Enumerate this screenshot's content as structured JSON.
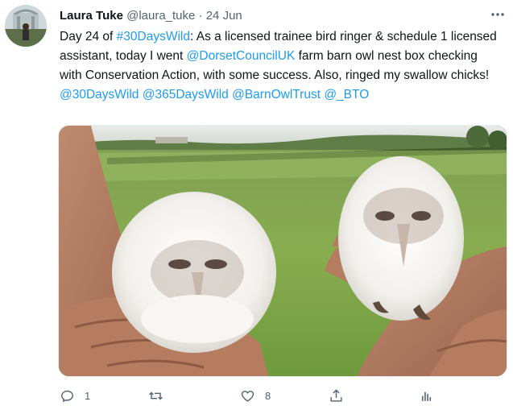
{
  "tweet": {
    "author_name": "Laura Tuke",
    "author_handle": "@laura_tuke",
    "separator": "·",
    "date": "24 Jun",
    "text_parts": {
      "p1": "Day 24 of ",
      "tag1": "#30DaysWild",
      "p2": ": As a licensed trainee bird ringer & schedule 1 licensed assistant, today I went ",
      "mention1": "@DorsetCouncilUK",
      "p3": " farm barn owl nest box checking with Conservation Action, with some success. Also, ringed my swallow chicks!"
    },
    "footer_links": {
      "tag1": "@30DaysWild",
      "tag2": "@365DaysWild",
      "tag3": "@BarnOwlTrust",
      "tag4": "@_BTO"
    }
  },
  "actions": {
    "reply_count": "1",
    "retweet_count": "",
    "like_count": "8"
  },
  "icons": {
    "more": "more-horizontal-icon",
    "reply": "reply-icon",
    "retweet": "retweet-icon",
    "like": "heart-icon",
    "share": "share-icon",
    "analytics": "analytics-icon"
  },
  "colors": {
    "link": "#1d9bf0",
    "secondary_text": "#536471",
    "primary_text": "#0f1419"
  }
}
